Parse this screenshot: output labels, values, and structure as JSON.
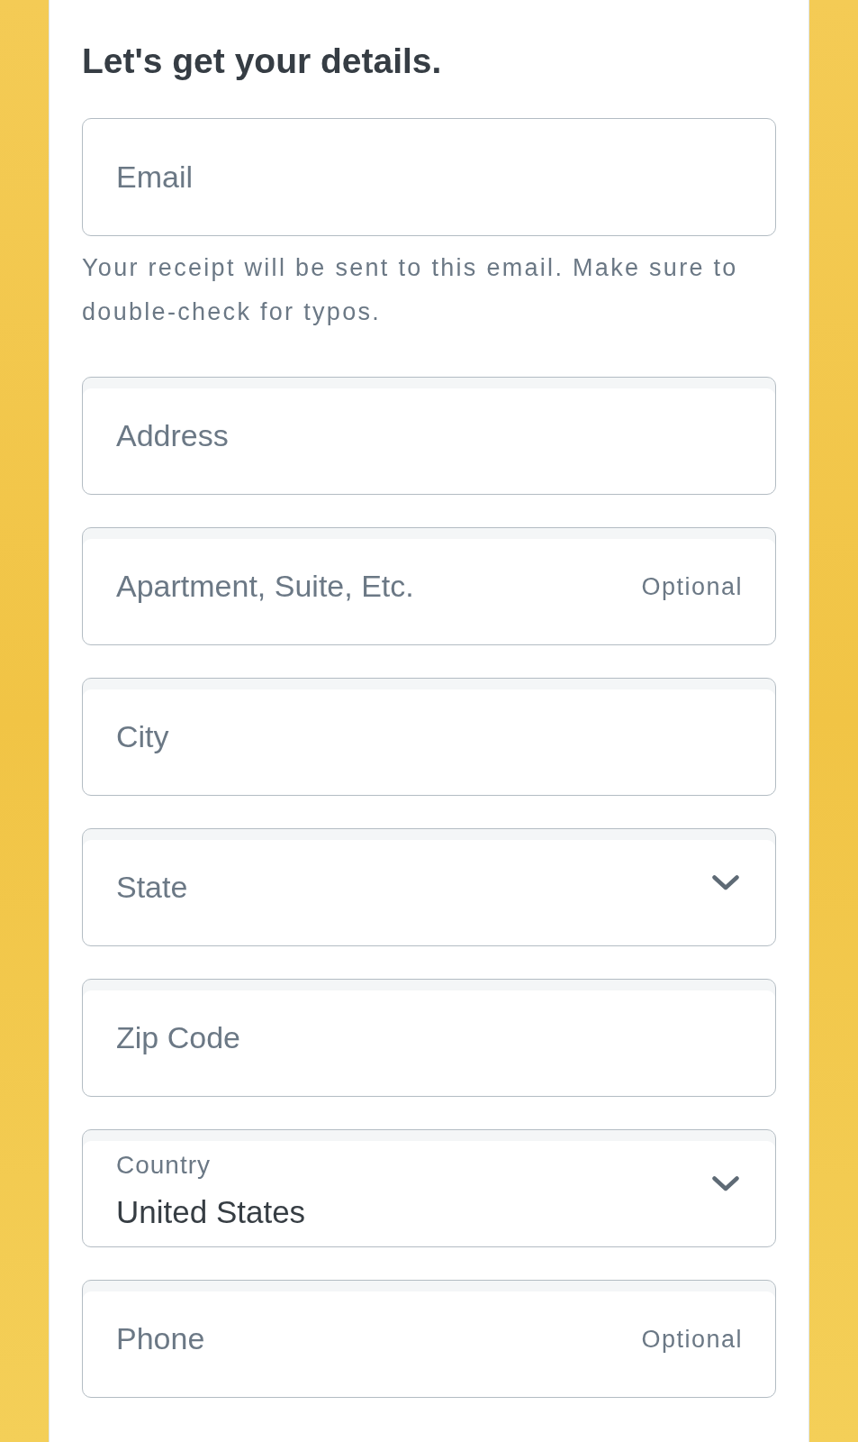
{
  "heading": "Let's get your details.",
  "email_field": {
    "placeholder": "Email"
  },
  "email_note": "Your receipt will be sent to this email. Make sure to double-check for typos.",
  "address_fields": [
    {
      "kind": "text",
      "placeholder": "Address"
    },
    {
      "kind": "text",
      "placeholder": "Apartment, Suite, Etc.",
      "optional_tag": "Optional"
    },
    {
      "kind": "text",
      "placeholder": "City"
    },
    {
      "kind": "select",
      "placeholder": "State"
    },
    {
      "kind": "text",
      "placeholder": "Zip Code"
    },
    {
      "kind": "select",
      "label": "Country",
      "value": "United States"
    },
    {
      "kind": "text",
      "placeholder": "Phone",
      "optional_tag": "Optional"
    }
  ]
}
